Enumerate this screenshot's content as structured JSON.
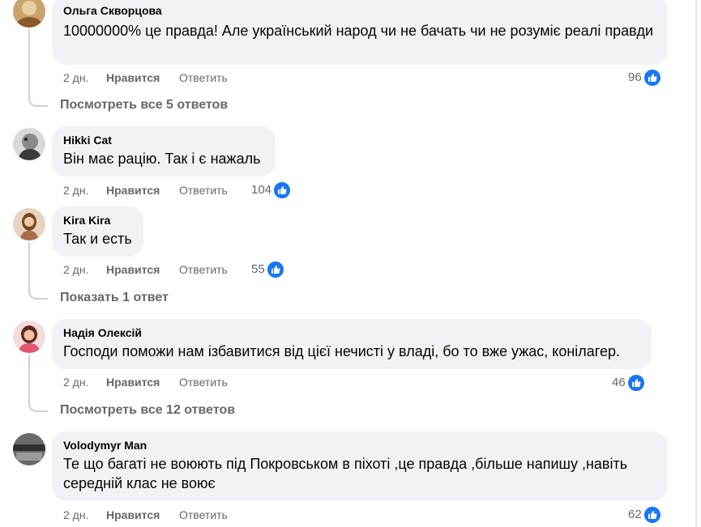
{
  "comments": [
    {
      "author": "Ольга Скворцова",
      "text": "10000000% це правда! Але український народ чи не бачать чи не розуміє реалі правди",
      "time": "2 дн.",
      "like_label": "Нравится",
      "reply_label": "Ответить",
      "reactions": "96",
      "thread_link": "Посмотреть все 5 ответов"
    },
    {
      "author": "Hikki Cat",
      "text": "Він має рацію. Так і є нажаль",
      "time": "2 дн.",
      "like_label": "Нравится",
      "reply_label": "Ответить",
      "reactions": "104"
    },
    {
      "author": "Kira Kira",
      "text": "Так и есть",
      "time": "2 дн.",
      "like_label": "Нравится",
      "reply_label": "Ответить",
      "reactions": "55",
      "thread_link": "Показать 1 ответ"
    },
    {
      "author": "Надія Олексій",
      "text": "Господи поможи нам ізбавитися від цієї нечисті у владі, бо то вже ужас, конілагер.",
      "time": "2 дн.",
      "like_label": "Нравится",
      "reply_label": "Ответить",
      "reactions": "46",
      "thread_link": "Посмотреть все 12 ответов"
    },
    {
      "author": "Volodymyr Man",
      "text": "Те що багаті не воюють під Покровськом в піхоті ,це правда ,більше напишу ,навіть середній клас не воює",
      "time": "2 дн.",
      "like_label": "Нравится",
      "reply_label": "Ответить",
      "reactions": "62"
    }
  ],
  "icons": {
    "reaction": "thumbs-up-icon",
    "avatar": "avatar-photo"
  },
  "colors": {
    "like_blue": "#1877f2",
    "bubble": "#f0f2f5",
    "muted_text": "#65676b"
  }
}
